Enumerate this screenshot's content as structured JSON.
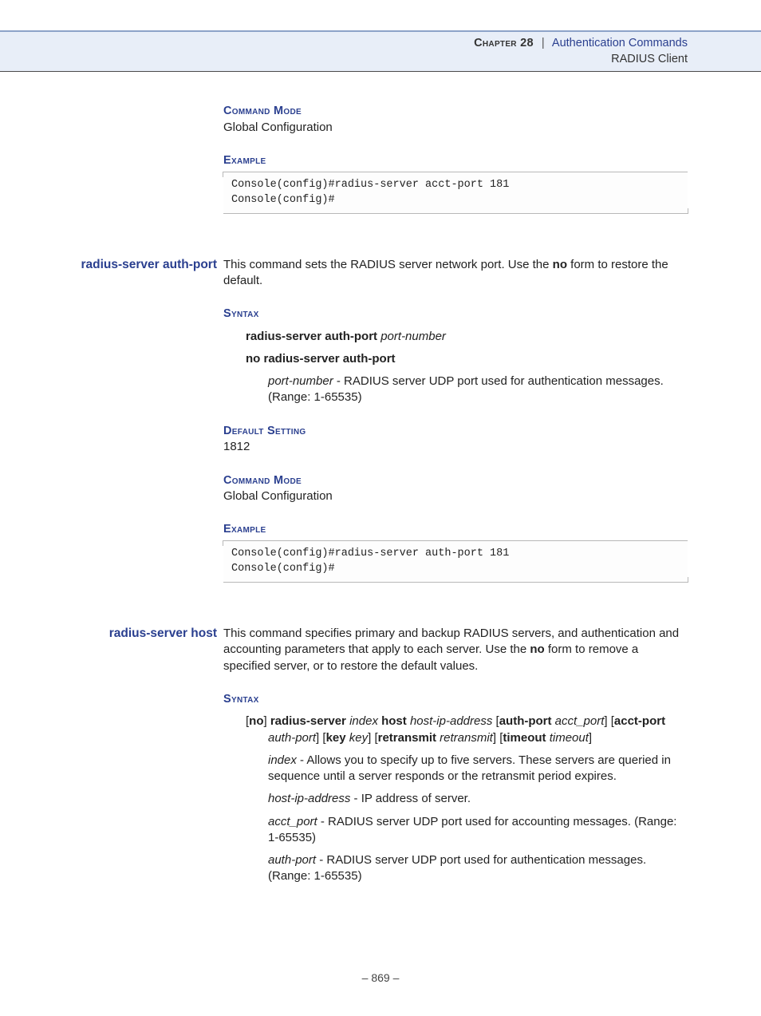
{
  "header": {
    "chapter_label": "Chapter 28",
    "separator": "|",
    "chapter_title": "Authentication Commands",
    "section": "RADIUS Client"
  },
  "block0": {
    "cmd_mode_label": "Command Mode",
    "cmd_mode_value": "Global Configuration",
    "example_label": "Example",
    "code": "Console(config)#radius-server acct-port 181\nConsole(config)#"
  },
  "block1": {
    "margin_title": "radius-server auth-port",
    "intro_a": "This command sets the RADIUS server network port. Use the ",
    "intro_no": "no",
    "intro_b": " form to restore the default.",
    "syntax_label": "Syntax",
    "syntax_cmd": "radius-server auth-port",
    "syntax_arg": "port-number",
    "syntax_no": "no radius-server auth-port",
    "param_name": "port-number",
    "param_desc": " - RADIUS server UDP port used for authentication messages. (Range: 1-65535)",
    "default_label": "Default Setting",
    "default_value": "1812",
    "cmd_mode_label": "Command Mode",
    "cmd_mode_value": "Global Configuration",
    "example_label": "Example",
    "code": "Console(config)#radius-server auth-port 181\nConsole(config)#"
  },
  "block2": {
    "margin_title": "radius-server host",
    "intro_a": "This command specifies primary and backup RADIUS servers, and authentication and accounting parameters that apply to each server. Use the ",
    "intro_no": "no",
    "intro_b": " form to remove a specified server, or to restore the default values.",
    "syntax_label": "Syntax",
    "syn": {
      "lb1": "[",
      "no": "no",
      "rb1": "] ",
      "rs": "radius-server ",
      "index": "index ",
      "host": "host ",
      "hostip": "host-ip-address ",
      "lb2": "[",
      "ap": "auth-port ",
      "apv": "acct_port",
      "rb2": "] ",
      "lb3": "[",
      "acp": "acct-port ",
      "acpv": "auth-port",
      "rb3": "] ",
      "lb4": "[",
      "key": "key ",
      "keyv": "key",
      "rb4": "] ",
      "lb5": "[",
      "ret": "retransmit ",
      "retv": "retransmit",
      "rb5": "] ",
      "lb6": "[",
      "to": "timeout ",
      "tov": "timeout",
      "rb6": "]"
    },
    "p_index_name": "index",
    "p_index_desc": " - Allows you to specify up to five servers. These servers are queried in sequence until a server responds or the retransmit period expires.",
    "p_host_name": "host-ip-address",
    "p_host_desc": " - IP address of server.",
    "p_acct_name": "acct_port",
    "p_acct_desc": " - RADIUS server UDP port used for accounting messages. (Range: 1-65535)",
    "p_auth_name": "auth-port",
    "p_auth_desc": " - RADIUS server UDP port used for authentication messages. (Range: 1-65535)"
  },
  "page_number": "–  869  –"
}
